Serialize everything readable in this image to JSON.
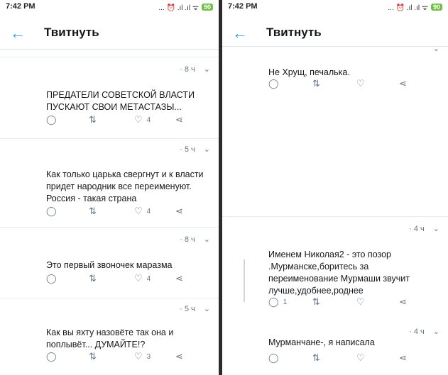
{
  "status": {
    "time": "7:42 PM",
    "icons": "... ⏰ .ıl .ıl ᯤ",
    "battery": "90"
  },
  "header": {
    "title": "Твитнуть"
  },
  "left": [
    {
      "time": "· 8 ч",
      "text": "ПРЕДАТЕЛИ СОВЕТСКОЙ ВЛАСТИ ПУСКАЮТ СВОИ МЕТАСТАЗЫ...",
      "likes": "4"
    },
    {
      "time": "· 5 ч",
      "text": "Как только царька свергнут и к власти придет народник все переименуют. Россия - такая страна",
      "likes": "4"
    },
    {
      "time": "· 8 ч",
      "text": "Это первый звоночек маразма",
      "likes": "4"
    },
    {
      "time": "· 5 ч",
      "text": "Как вы яхту назовёте так она и поплывёт...   ДУМАЙТЕ!?",
      "likes": "3"
    }
  ],
  "right": [
    {
      "text": "Не Хрущ, печалька."
    },
    {
      "time": "· 4 ч",
      "text": "Именем Николая2 - это позор .Мурманске,боритесь за переименование Мурмаши звучит лучше,удобнее,роднее",
      "replies": "1"
    },
    {
      "time": "· 4 ч",
      "text": "Мурманчане-, я написала"
    }
  ]
}
